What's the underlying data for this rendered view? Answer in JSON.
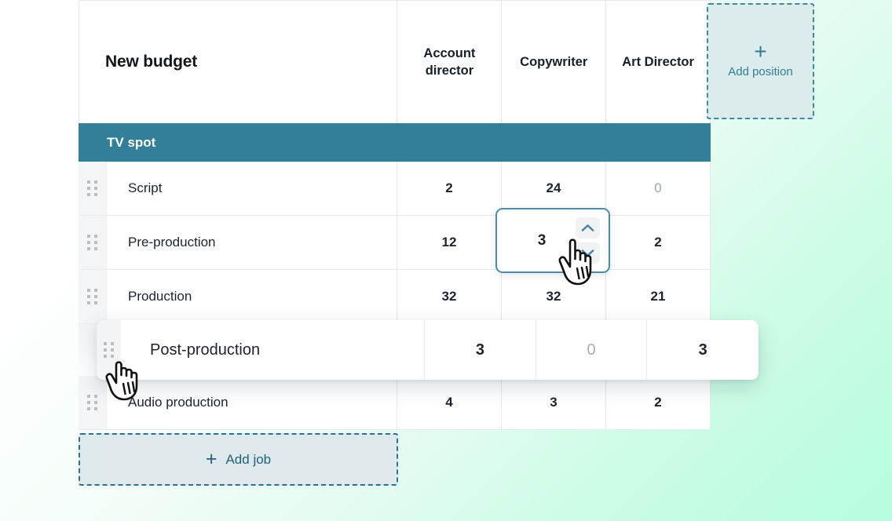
{
  "table": {
    "title": "New budget",
    "columns": [
      "Account director",
      "Copywriter",
      "Art Director"
    ],
    "add_position": {
      "label": "Add position",
      "icon": "plus-icon"
    },
    "add_job": {
      "label": "Add job",
      "icon": "plus-icon"
    },
    "groups": [
      {
        "name": "TV spot",
        "rows": [
          {
            "name": "Script",
            "values": [
              "2",
              "24",
              "0"
            ],
            "zero_flags": [
              false,
              false,
              true
            ]
          },
          {
            "name": "Pre-production",
            "values": [
              "12",
              "3",
              "2"
            ],
            "zero_flags": [
              false,
              false,
              false
            ]
          },
          {
            "name": "Production",
            "values": [
              "32",
              "32",
              "21"
            ],
            "zero_flags": [
              false,
              false,
              false
            ]
          },
          {
            "name": "Audio production",
            "values": [
              "4",
              "3",
              "2"
            ],
            "zero_flags": [
              false,
              false,
              false
            ]
          }
        ]
      }
    ]
  },
  "stepper": {
    "value": "3",
    "increment_icon": "chevron-up-icon",
    "decrement_icon": "chevron-down-icon"
  },
  "dragging_row": {
    "name": "Post-production",
    "values": [
      "3",
      "0",
      "3"
    ],
    "zero_flags": [
      false,
      true,
      false
    ],
    "handle_icon": "drag-handle-icon"
  },
  "cursors": {
    "pointing": "pointing-hand-cursor",
    "grabbing": "grabbing-hand-cursor"
  },
  "colors": {
    "group_header_bg": "#337e99",
    "accent_teal": "#2f7d92",
    "accent_blue": "#23607e",
    "add_box_bg": "#dcebec",
    "muted_number": "#97a6b4",
    "background_gradient_start": "#ffffff",
    "background_gradient_end": "#b6fddf"
  }
}
